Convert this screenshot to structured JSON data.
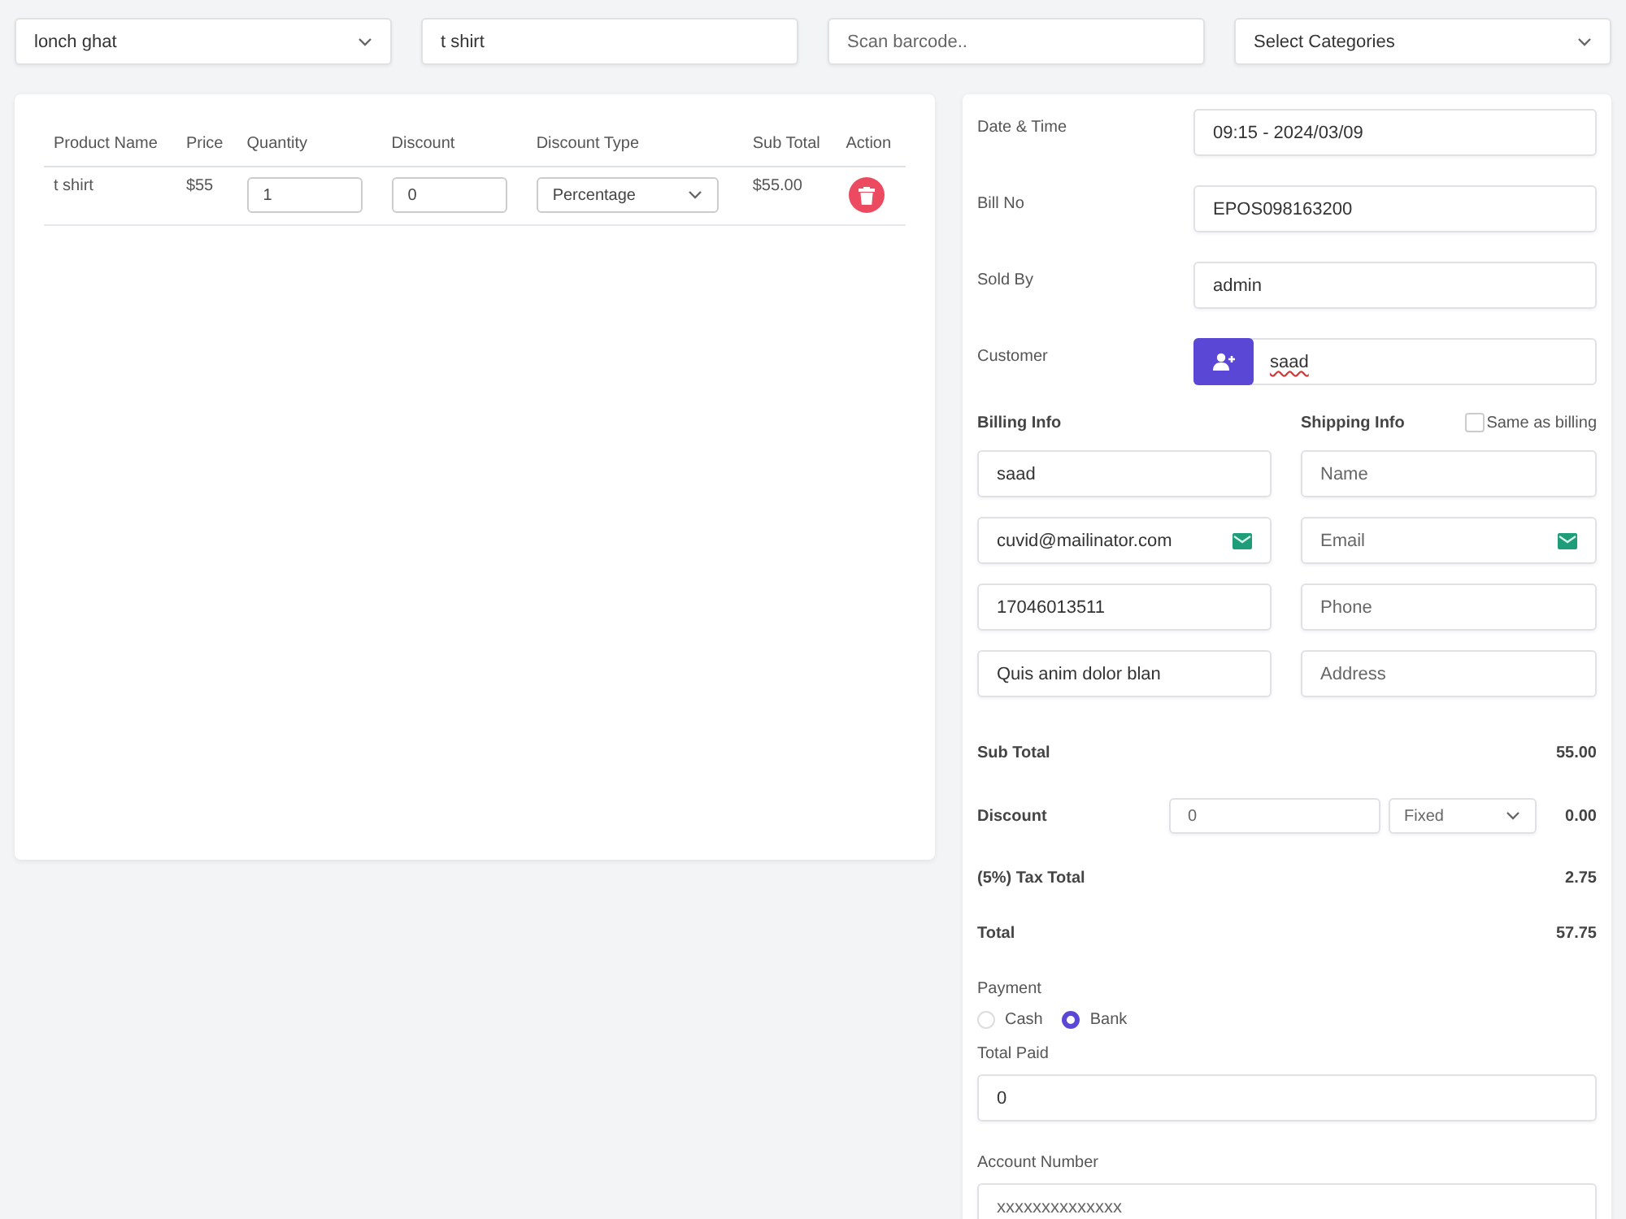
{
  "filters": [
    {
      "kind": "select",
      "value": "lonch ghat"
    },
    {
      "kind": "input",
      "value": "t shirt"
    },
    {
      "kind": "input",
      "placeholder": "Scan barcode.."
    },
    {
      "kind": "select",
      "value": "Select Categories"
    }
  ],
  "cart": {
    "columns": [
      "Product Name",
      "Price",
      "Quantity",
      "Discount",
      "Discount Type",
      "Sub Total",
      "Action"
    ],
    "rows": [
      {
        "product": "t shirt",
        "price": "$55",
        "quantity": "1",
        "discount": "0",
        "discount_type": "Percentage",
        "sub_total": "$55.00"
      }
    ]
  },
  "details": [
    {
      "label": "Date & Time",
      "value": "09:15 - 2024/03/09",
      "kind": "input"
    },
    {
      "label": "Bill No",
      "value": "EPOS098163200",
      "kind": "input"
    },
    {
      "label": "Sold By",
      "value": "admin",
      "kind": "input"
    },
    {
      "label": "Customer",
      "value": "saad",
      "kind": "customer"
    }
  ],
  "billing": {
    "title": "Billing Info",
    "fields": [
      {
        "value": "saad"
      },
      {
        "value": "cuvid@mailinator.com",
        "icon": true
      },
      {
        "value": "17046013511"
      },
      {
        "value": "Quis anim dolor blan"
      }
    ]
  },
  "shipping": {
    "title": "Shipping Info",
    "same_as_billing": {
      "label": "Same as billing",
      "checked": false
    },
    "fields": [
      {
        "placeholder": "Name"
      },
      {
        "placeholder": "Email",
        "icon": true
      },
      {
        "placeholder": "Phone"
      },
      {
        "placeholder": "Address"
      }
    ]
  },
  "summary": [
    {
      "kind": "amount",
      "label": "Sub Total",
      "value": "55.00"
    },
    {
      "kind": "discount",
      "label": "Discount",
      "input": "0",
      "type": "Fixed",
      "value": "0.00"
    },
    {
      "kind": "amount",
      "label": "(5%) Tax Total",
      "value": "2.75"
    },
    {
      "kind": "amount",
      "label": "Total",
      "value": "57.75"
    }
  ],
  "payment": {
    "label": "Payment",
    "options": [
      {
        "label": "Cash",
        "selected": false
      },
      {
        "label": "Bank",
        "selected": true
      }
    ]
  },
  "total_paid": {
    "label": "Total Paid",
    "value": "0"
  },
  "account_number": {
    "label": "Account Number",
    "placeholder": "xxxxxxxxxxxxxx"
  }
}
